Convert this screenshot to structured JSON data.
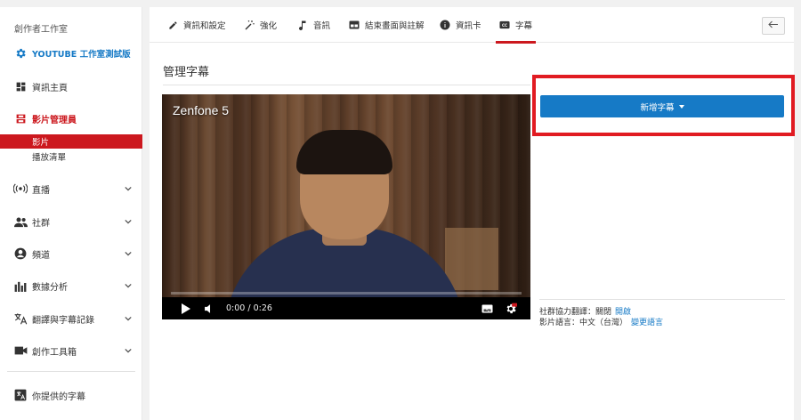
{
  "sidebar": {
    "title": "創作者工作室",
    "studio_label": "YOUTUBE 工作室測試版",
    "items": [
      {
        "label": "資訊主頁"
      },
      {
        "label": "影片管理員"
      },
      {
        "label": "直播"
      },
      {
        "label": "社群"
      },
      {
        "label": "頻道"
      },
      {
        "label": "數據分析"
      },
      {
        "label": "翻譯與字幕記錄"
      },
      {
        "label": "創作工具箱"
      }
    ],
    "sub_items": [
      {
        "label": "影片",
        "active": true
      },
      {
        "label": "播放清單",
        "active": false
      }
    ],
    "contributed_label": "你提供的字幕"
  },
  "tabs": [
    {
      "label": "資訊和設定",
      "icon": "pencil-icon"
    },
    {
      "label": "強化",
      "icon": "magic-wand-icon"
    },
    {
      "label": "音訊",
      "icon": "music-note-icon"
    },
    {
      "label": "結束畫面與註解",
      "icon": "end-screen-icon"
    },
    {
      "label": "資訊卡",
      "icon": "info-icon"
    },
    {
      "label": "字幕",
      "icon": "cc-icon",
      "active": true
    }
  ],
  "main": {
    "title": "管理字幕",
    "video": {
      "title": "Zenfone 5",
      "time": "0:00 / 0:26"
    },
    "add_subtitle_label": "新增字幕",
    "community": {
      "label": "社群協力翻譯：關閉",
      "action": "開啟"
    },
    "language": {
      "label": "影片語言：中文（台灣）",
      "action": "變更語言"
    }
  },
  "colors": {
    "accent_red": "#cc181e",
    "link_blue": "#167ac6",
    "highlight_red": "#e11b22"
  }
}
